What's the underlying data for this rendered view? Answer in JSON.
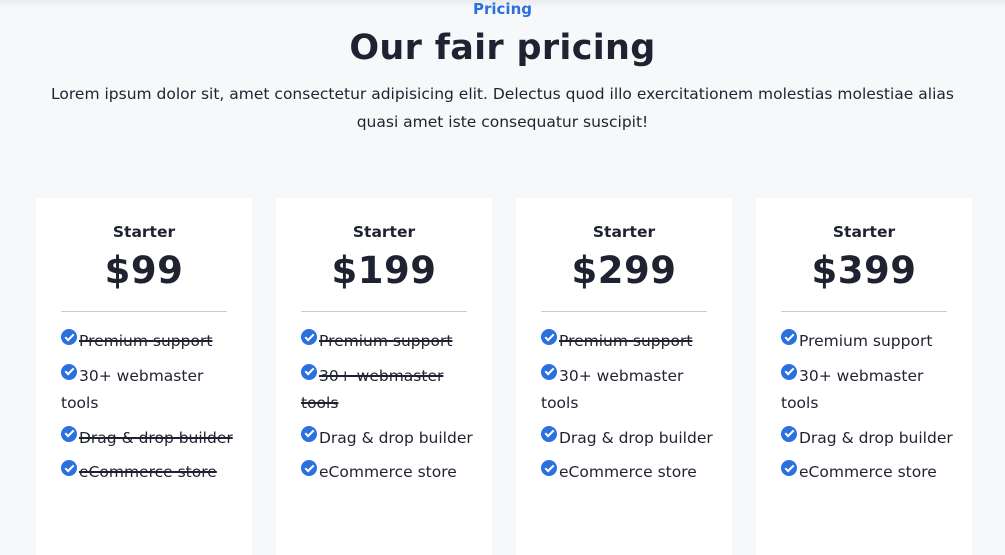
{
  "header": {
    "eyebrow": "Pricing",
    "title": "Our fair pricing",
    "lead": "Lorem ipsum dolor sit, amet consectetur adipisicing elit. Delectus quod illo exercitationem molestias molestiae alias quasi amet iste consequatur suscipit!"
  },
  "colors": {
    "accent": "#2b6fe0",
    "text": "#1f2230",
    "background": "#f7f8fa",
    "card": "#ffffff"
  },
  "icons": {
    "feature": "check-circle-icon"
  },
  "plans": [
    {
      "name": "Starter",
      "price": "$99",
      "features": [
        {
          "label": "Premium support",
          "included": false
        },
        {
          "label": "30+ webmaster tools",
          "included": true
        },
        {
          "label": "Drag & drop builder",
          "included": false
        },
        {
          "label": "eCommerce store",
          "included": false
        }
      ]
    },
    {
      "name": "Starter",
      "price": "$199",
      "features": [
        {
          "label": "Premium support",
          "included": false
        },
        {
          "label": "30+ webmaster tools",
          "included": false
        },
        {
          "label": "Drag & drop builder",
          "included": true
        },
        {
          "label": "eCommerce store",
          "included": true
        }
      ]
    },
    {
      "name": "Starter",
      "price": "$299",
      "features": [
        {
          "label": "Premium support",
          "included": false
        },
        {
          "label": "30+ webmaster tools",
          "included": true
        },
        {
          "label": "Drag & drop builder",
          "included": true
        },
        {
          "label": "eCommerce store",
          "included": true
        }
      ]
    },
    {
      "name": "Starter",
      "price": "$399",
      "features": [
        {
          "label": "Premium support",
          "included": true
        },
        {
          "label": "30+ webmaster tools",
          "included": true
        },
        {
          "label": "Drag & drop builder",
          "included": true
        },
        {
          "label": "eCommerce store",
          "included": true
        }
      ]
    }
  ]
}
